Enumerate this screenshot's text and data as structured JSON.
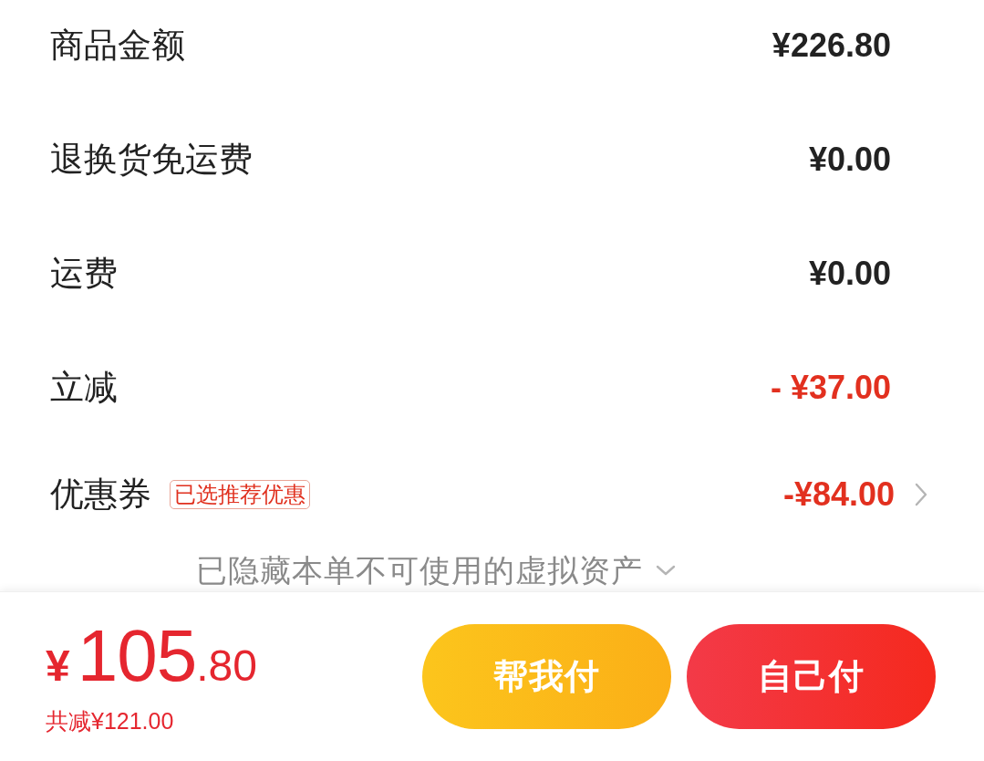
{
  "rows": [
    {
      "kind": "amount",
      "label": "商品金额",
      "value": "¥226.80"
    },
    {
      "kind": "amount",
      "label": "退换货免运费",
      "value": "¥0.00"
    },
    {
      "kind": "amount",
      "label": "运费",
      "value": "¥0.00"
    },
    {
      "kind": "discount",
      "label": "立减",
      "value": "- ¥37.00"
    },
    {
      "kind": "coupon",
      "label": "优惠券",
      "tag": "已选推荐优惠",
      "value": "-¥84.00"
    }
  ],
  "hidden_assets": {
    "text": "已隐藏本单不可使用的虚拟资产",
    "expanded": false
  },
  "footer": {
    "total": {
      "currency": "¥",
      "integer": "105",
      "decimal": ".80"
    },
    "saving": "共减¥121.00",
    "buttons": [
      {
        "kind": "secondary",
        "label": "帮我付"
      },
      {
        "kind": "primary",
        "label": "自己付"
      }
    ]
  }
}
